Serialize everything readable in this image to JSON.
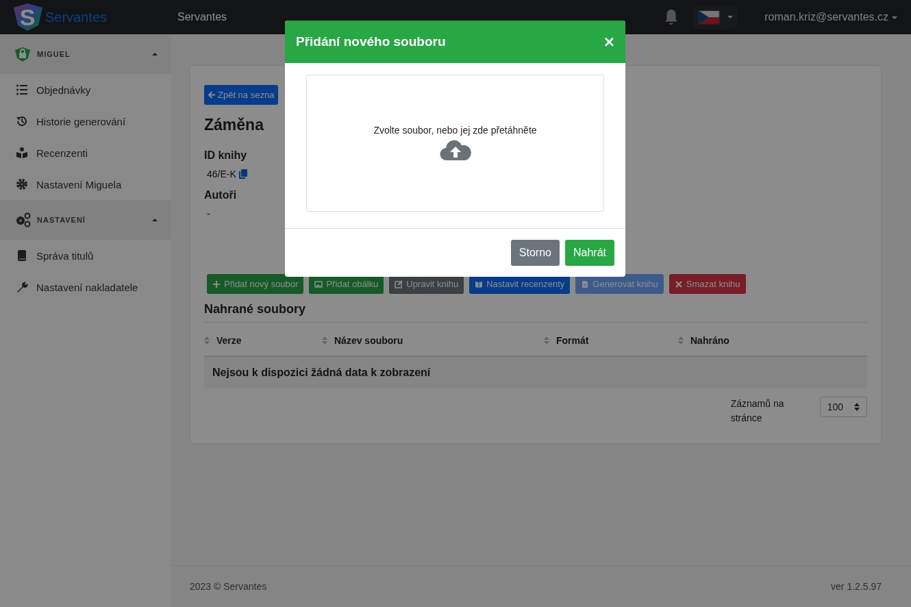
{
  "navbar": {
    "logo_letter": "S",
    "brand": "Servantes",
    "title": "Servantes",
    "user": "roman.kriz@servantes.cz"
  },
  "sidebar": {
    "sections": [
      {
        "title": "MIGUEL",
        "expanded": true,
        "items": [
          {
            "label": "Objednávky"
          },
          {
            "label": "Historie generování"
          },
          {
            "label": "Recenzenti"
          },
          {
            "label": "Nastavení Miguela"
          }
        ]
      },
      {
        "title": "NASTAVENÍ",
        "expanded": true,
        "items": [
          {
            "label": "Správa titulů"
          },
          {
            "label": "Nastavení nakladatele"
          }
        ]
      }
    ]
  },
  "book": {
    "back_button": "Zpět na sezna",
    "title": "Záměna",
    "fields": [
      {
        "label": "ID knihy",
        "value": "46/E-K",
        "copyable": true
      },
      {
        "label": "Autoři",
        "value": "-",
        "copyable": false
      }
    ]
  },
  "actions": [
    {
      "label": "Přidat nový soubor",
      "disabled": false
    },
    {
      "label": "Přidat obálku",
      "disabled": false
    },
    {
      "label": "Upravit knihu",
      "disabled": false
    },
    {
      "label": "Nastavit recenzenty",
      "disabled": false
    },
    {
      "label": "Generovat knihu",
      "disabled": true
    },
    {
      "label": "Smazat knihu",
      "disabled": false
    }
  ],
  "files": {
    "heading": "Nahrané soubory",
    "columns": [
      "Verze",
      "Název souboru",
      "Formát",
      "Nahráno"
    ],
    "empty_message": "Nejsou k dispozici žádná data k zobrazení",
    "page_size_label": "Záznamů na stránce",
    "page_size": "100"
  },
  "footer": {
    "copyright": "2023 © Servantes",
    "version": "ver 1.2.5.97"
  },
  "modal": {
    "title": "Přidání nového souboru",
    "close": "×",
    "dropzone_text": "Zvolte soubor, nebo jej zde přetáhněte",
    "buttons": [
      {
        "label": "Storno"
      },
      {
        "label": "Nahrát"
      }
    ]
  }
}
